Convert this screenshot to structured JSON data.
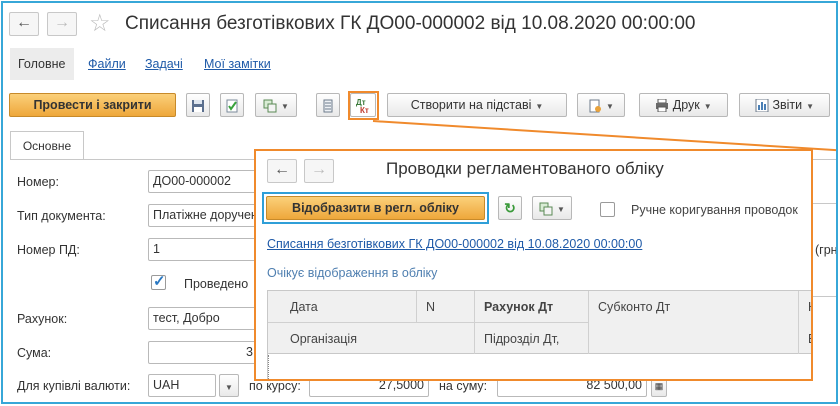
{
  "window": {
    "title": "Списання безготівкових ГК ДО00-000002 від 10.08.2020 00:00:00"
  },
  "tabs": [
    {
      "label": "Головне"
    },
    {
      "label": "Файли"
    },
    {
      "label": "Задачі"
    },
    {
      "label": "Мої замітки"
    }
  ],
  "toolbar": {
    "post_close": "Провести і закрити",
    "create_based": "Створити на підставі",
    "print": "Друк",
    "reports": "Звіти"
  },
  "form": {
    "tab": "Основне",
    "number_label": "Номер:",
    "number_value": "ДО00-000002",
    "doctype_label": "Тип документа:",
    "doctype_value": "Платіжне доручення",
    "pd_label": "Номер ПД:",
    "pd_value": "1",
    "right_unit": "(грн",
    "posted_label": "Проведено",
    "account_label": "Рахунок:",
    "account_value": "тест, Добро",
    "sum_label": "Сума:",
    "sum_value": "3",
    "fx_label": "Для купівлі валюти:",
    "currency_value": "UAH",
    "rate_label": "по курсу:",
    "rate_value": "27,5000",
    "amount_label": "на суму:",
    "amount_value": "82 500,00"
  },
  "popup": {
    "title": "Проводки регламентованого обліку",
    "reflect_button": "Відобразити в регл. обліку",
    "manual_label": "Ручне коригування проводок",
    "doc_link": "Списання безготівкових ГК ДО00-000002 від 10.08.2020 00:00:00",
    "status": "Очікує відображення в обліку",
    "columns": {
      "date": "Дата",
      "n": "N",
      "debit_account": "Рахунок Дт",
      "subconto": "Субконто Дт",
      "k": "К",
      "org": "Організація",
      "dept": "Підрозділ Дт,",
      "v": "В"
    }
  },
  "colors": {
    "highlight": "#f08a2c",
    "frame": "#37a7d8",
    "primary": "#eea73b",
    "link": "#1f5aa8"
  }
}
